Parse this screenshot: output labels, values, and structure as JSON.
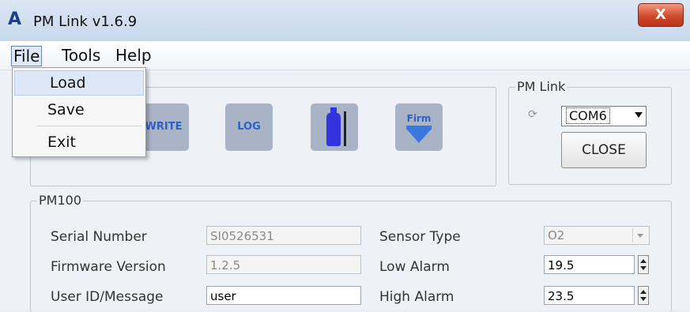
{
  "window": {
    "title": "PM Link v1.6.9",
    "app_icon_glyph": "A",
    "close_glyph": "X"
  },
  "menubar": {
    "items": [
      "File",
      "Tools",
      "Help"
    ]
  },
  "file_menu": {
    "items": [
      "Load",
      "Save",
      "Exit"
    ],
    "highlighted": "Load"
  },
  "toolbar": {
    "buttons": [
      {
        "label": "WRITE",
        "icon": "write-icon"
      },
      {
        "label": "LOG",
        "icon": "log-icon"
      },
      {
        "label": "",
        "icon": "gas-cylinder-icon"
      },
      {
        "label": "Firm",
        "icon": "firmware-download-icon"
      }
    ]
  },
  "pm_link": {
    "legend": "PM Link",
    "port": "COM6",
    "close_label": "CLOSE",
    "refresh_icon": "refresh-icon"
  },
  "pm100": {
    "legend": "PM100",
    "serial_number_label": "Serial Number",
    "serial_number": "SI0526531",
    "firmware_version_label": "Firmware Version",
    "firmware_version": "1.2.5",
    "user_id_label": "User ID/Message",
    "user_id": "user",
    "sensor_type_label": "Sensor Type",
    "sensor_type": "O2",
    "low_alarm_label": "Low Alarm",
    "low_alarm": "19.5",
    "high_alarm_label": "High Alarm",
    "high_alarm": "23.5"
  },
  "colors": {
    "close_button": "#cf4a2c",
    "toolbar_button_bg": "#a9b3c6",
    "icon_blue": "#3333e0"
  }
}
